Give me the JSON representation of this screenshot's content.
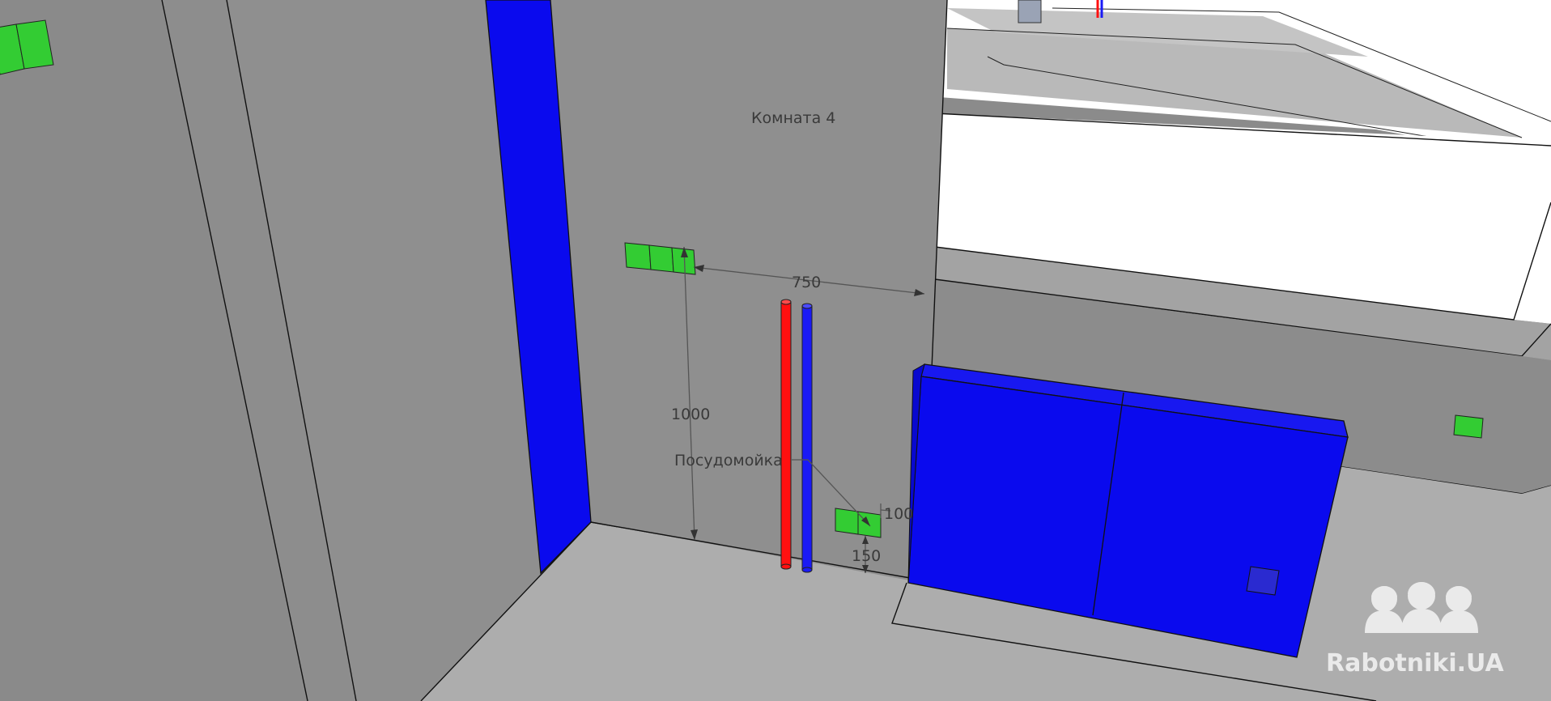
{
  "scene": {
    "room_label": "Комната 4",
    "dishwasher_label": "Посудомойка",
    "dimensions": {
      "horizontal_to_corner": "750",
      "height_from_floor": "1000",
      "socket_side_offset": "100",
      "socket_height": "150"
    }
  },
  "watermark": {
    "text": "Rabotniki.UA",
    "icon": "three-workers-helmets-icon"
  },
  "colors": {
    "wall_main": "#8f8f8f",
    "wall_side": "#8a8a8a",
    "floor": "#acacac",
    "pipe_hot": "#ff1010",
    "pipe_cold": "#1a1af5",
    "column": "#0a0aee",
    "socket": "#33cc33",
    "background_upper": "#ffffff"
  }
}
